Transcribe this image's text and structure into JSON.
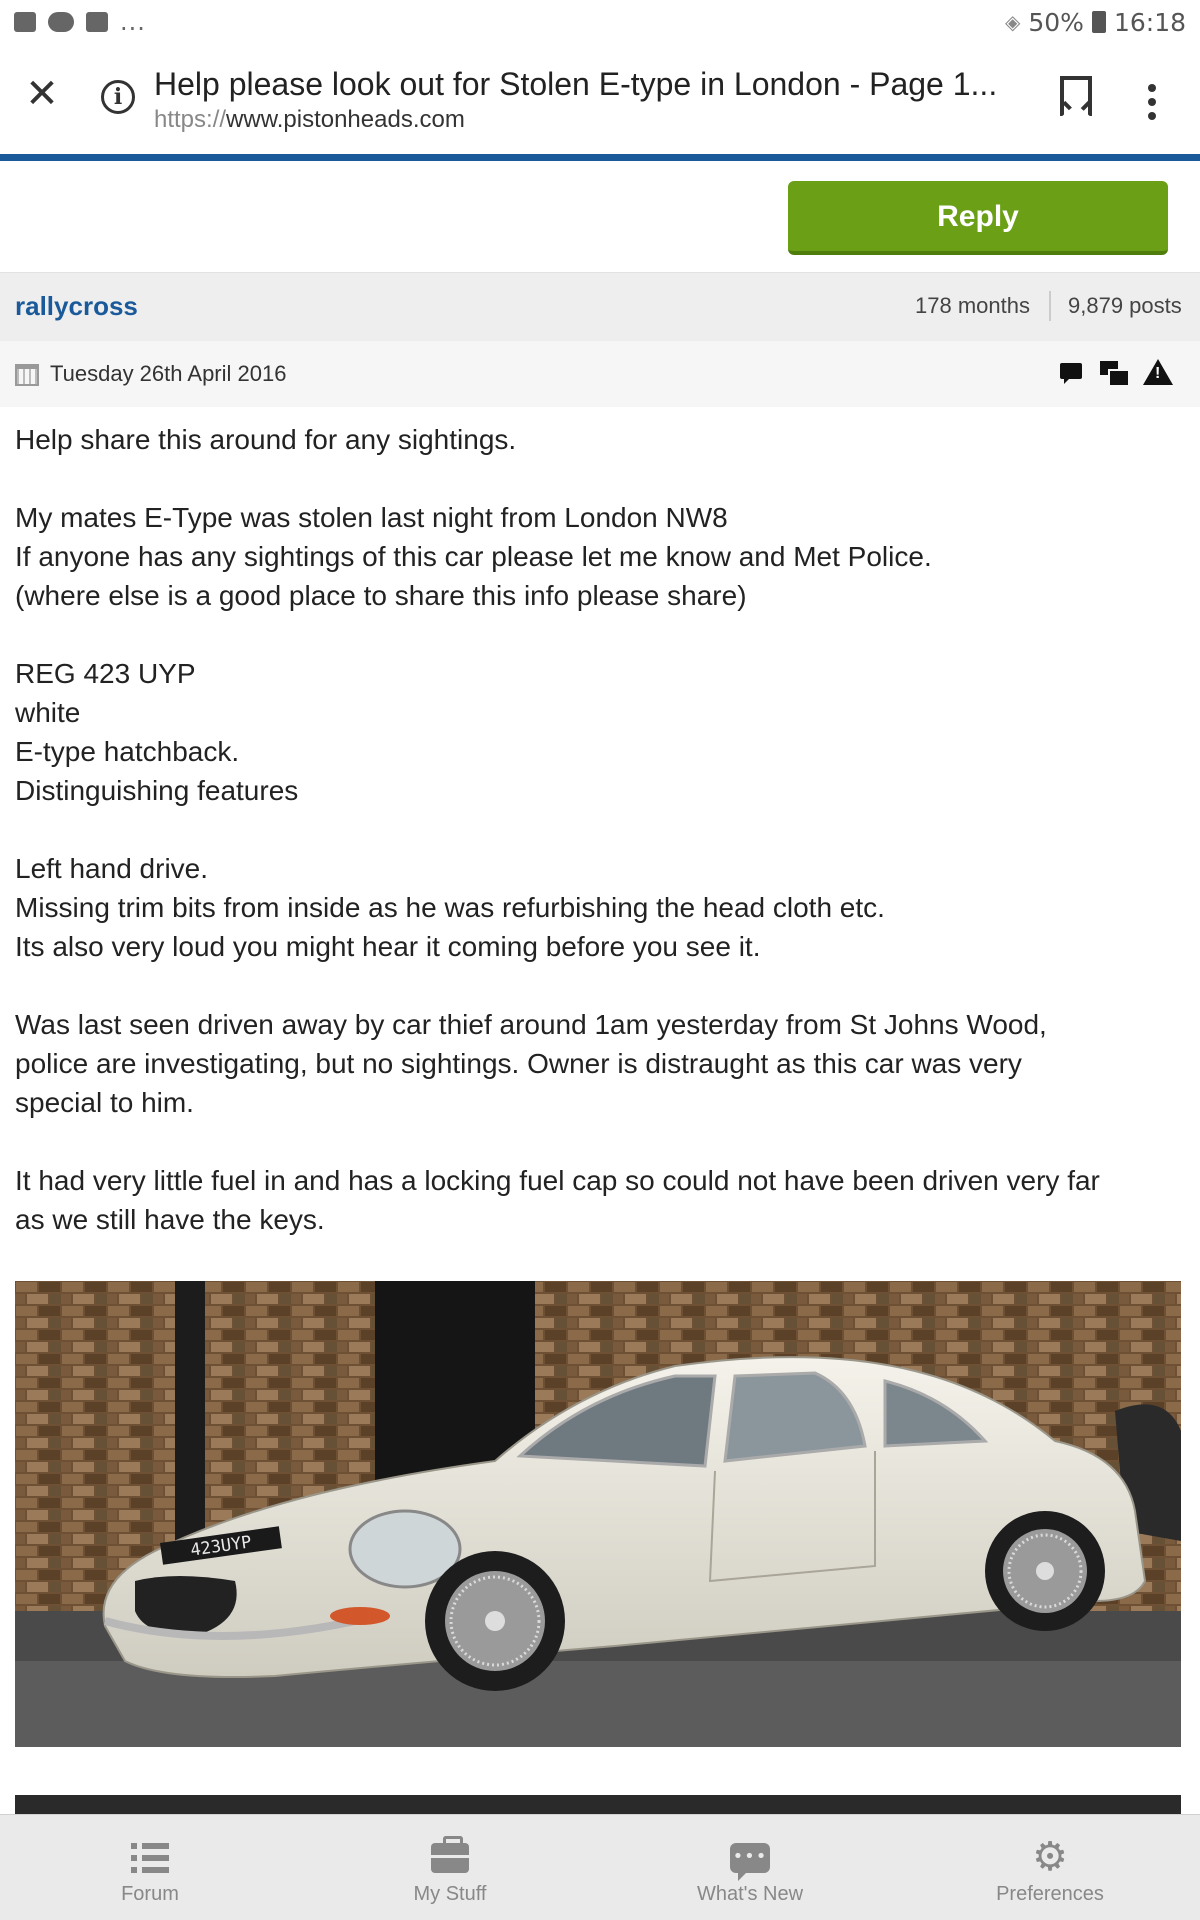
{
  "status_bar": {
    "notification_dots": "...",
    "battery_percent": "50%",
    "time": "16:18"
  },
  "browser": {
    "page_title": "Help please look out for Stolen E-type in London - Page 1...",
    "url_protocol": "https://",
    "url_host": "www.pistonheads.com",
    "accent_color": "#1a5a9a"
  },
  "toolbar": {
    "reply_label": "Reply",
    "reply_color": "#6a9f16"
  },
  "post": {
    "author": "rallycross",
    "months": "178 months",
    "posts": "9,879 posts",
    "date": "Tuesday 26th April 2016",
    "paragraphs": [
      [
        "Help share this around for any sightings."
      ],
      [
        "My mates E-Type was stolen last night from London NW8",
        "If anyone has any sightings of this car please let me know and Met Police.",
        "(where else is a good place to share this info please share)"
      ],
      [
        "REG 423 UYP",
        "white",
        "E-type hatchback.",
        "Distinguishing features"
      ],
      [
        "Left hand drive.",
        "Missing trim bits from inside as he was refurbishing the head cloth etc.",
        "Its also very loud you might hear it coming before you see it."
      ],
      [
        "Was last seen driven away by car thief around 1am yesterday from St Johns Wood,",
        "police are investigating, but no sightings. Owner is distraught as this car was very",
        "special to him."
      ],
      [
        "It had very little fuel in and has a locking fuel cap so could not have been driven very far",
        "as we still have the keys."
      ]
    ],
    "image_plate_text": "423UYP"
  },
  "bottom_nav": {
    "items": [
      {
        "label": "Forum",
        "icon": "list-icon"
      },
      {
        "label": "My Stuff",
        "icon": "briefcase-icon"
      },
      {
        "label": "What's New",
        "icon": "chat-icon"
      },
      {
        "label": "Preferences",
        "icon": "gear-icon"
      }
    ]
  }
}
